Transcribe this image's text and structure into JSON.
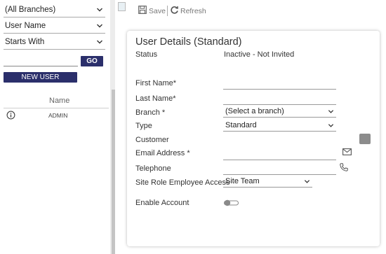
{
  "filters": {
    "branch": "(All Branches)",
    "field": "User Name",
    "operator": "Starts With",
    "search_value": "",
    "go_label": "GO",
    "new_user_label": "NEW USER"
  },
  "grid": {
    "column_name": "Name",
    "rows": [
      {
        "icon": "info-icon",
        "name": "ADMIN"
      }
    ]
  },
  "toolbar": {
    "save_label": "Save",
    "refresh_label": "Refresh"
  },
  "form": {
    "title": "User Details (Standard)",
    "status_label": "Status",
    "status_value": "Inactive - Not Invited",
    "first_name_label": "First Name*",
    "first_name_value": "",
    "last_name_label": "Last Name*",
    "last_name_value": "",
    "branch_label": "Branch *",
    "branch_value": "(Select a branch)",
    "type_label": "Type",
    "type_value": "Standard",
    "customer_label": "Customer",
    "email_label": "Email Address *",
    "email_value": "",
    "telephone_label": "Telephone",
    "telephone_value": "",
    "site_role_label": "Site Role Employee Access",
    "site_role_value": "Site Team",
    "enable_label": "Enable Account",
    "enable_value": false
  },
  "colors": {
    "primary_button": "#2b2f6b",
    "toggle_off": "#888888"
  }
}
